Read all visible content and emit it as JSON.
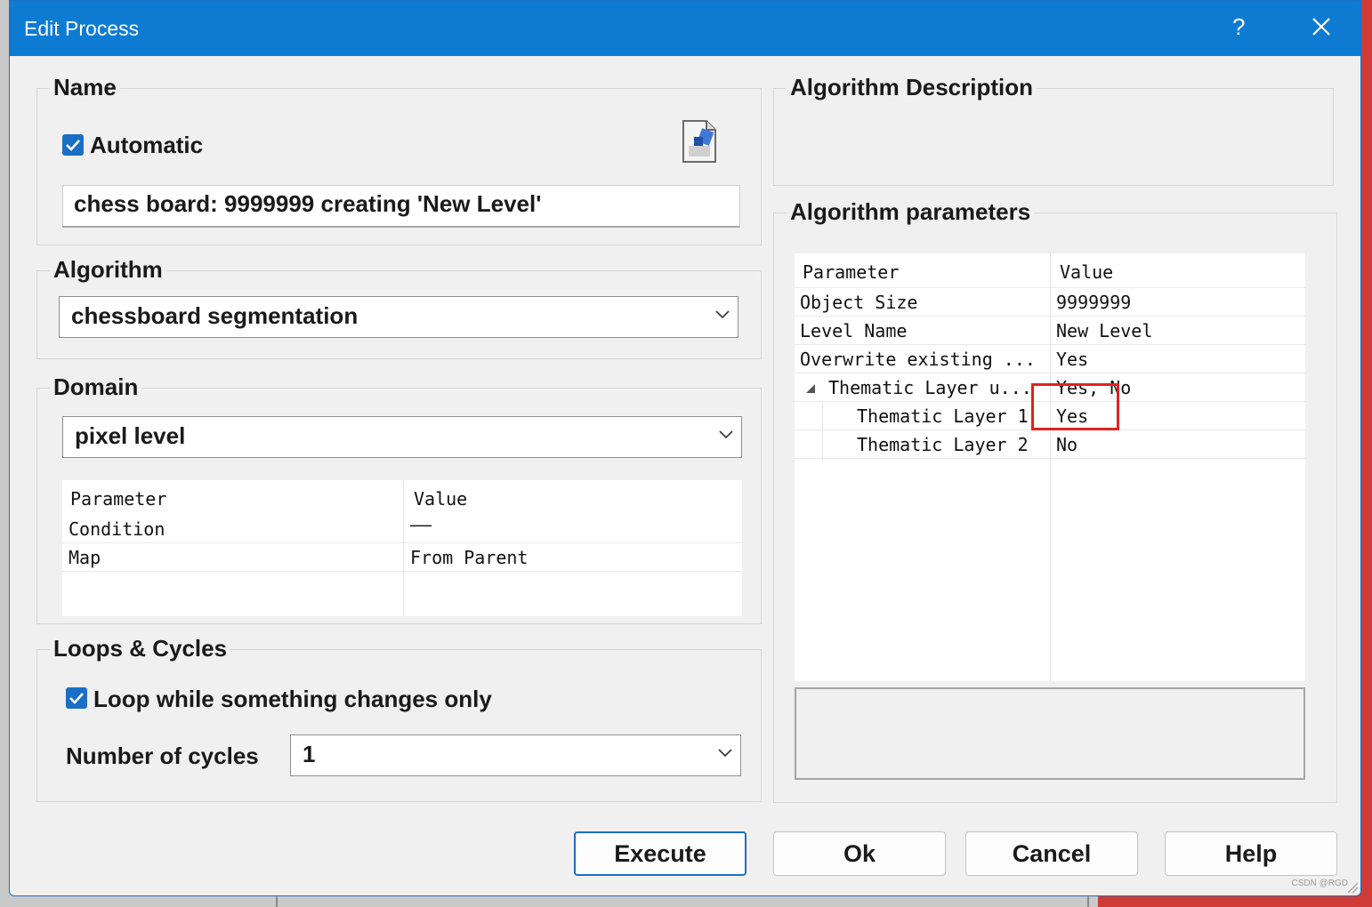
{
  "window": {
    "title": "Edit Process",
    "help_label": "?"
  },
  "name_group": {
    "legend": "Name",
    "automatic_label": "Automatic",
    "automatic_checked": true,
    "name_value": "chess board: 9999999 creating 'New Level'"
  },
  "algorithm_group": {
    "legend": "Algorithm",
    "selected": "chessboard segmentation"
  },
  "domain_group": {
    "legend": "Domain",
    "selected": "pixel level",
    "table": {
      "headers": [
        "Parameter",
        "Value"
      ],
      "rows": [
        {
          "param": "Condition",
          "value": "——"
        },
        {
          "param": "Map",
          "value": "From Parent"
        }
      ]
    }
  },
  "loops_group": {
    "legend": "Loops & Cycles",
    "loop_label": "Loop while something changes only",
    "loop_checked": true,
    "cycles_label": "Number of cycles",
    "cycles_value": "1"
  },
  "description_group": {
    "legend": "Algorithm Description"
  },
  "parameters_group": {
    "legend": "Algorithm parameters",
    "table": {
      "headers": [
        "Parameter",
        "Value"
      ],
      "rows": [
        {
          "param": "Object Size",
          "value": "9999999"
        },
        {
          "param": "Level Name",
          "value": "New Level"
        },
        {
          "param": "Overwrite existing ...",
          "value": "Yes"
        },
        {
          "param": "Thematic Layer u...",
          "value": "Yes, No",
          "expanded": true
        },
        {
          "param": "Thematic Layer 1",
          "value": "Yes",
          "highlighted": true
        },
        {
          "param": "Thematic Layer 2",
          "value": "No"
        }
      ]
    },
    "highlight_color": "#e0221f"
  },
  "buttons": {
    "execute": "Execute",
    "ok": "Ok",
    "cancel": "Cancel",
    "help": "Help"
  },
  "colors": {
    "titlebar": "#0e7bd3",
    "accent": "#1a6fc4"
  },
  "watermark": "CSDN @RGD"
}
